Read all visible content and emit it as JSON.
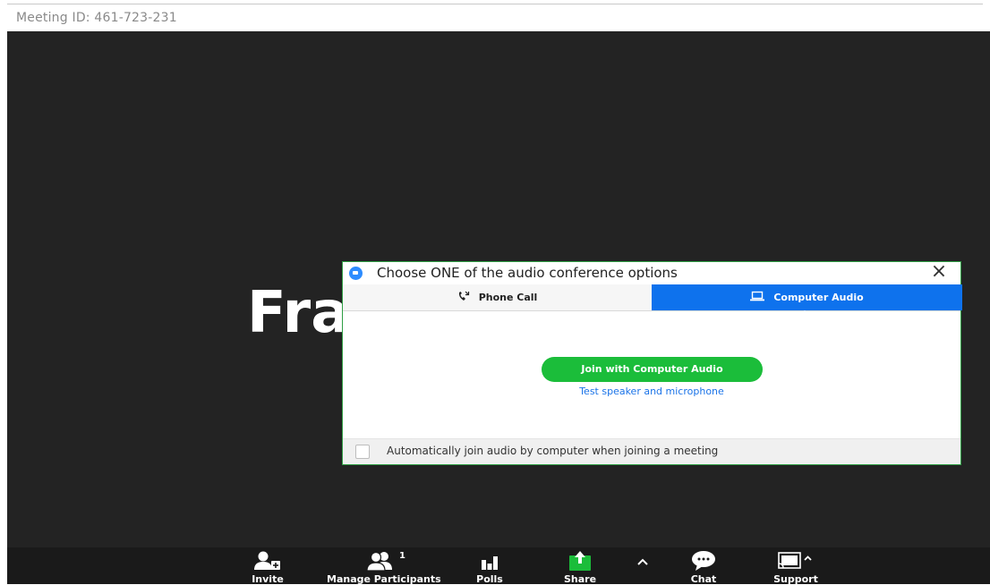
{
  "header": {
    "meeting_id": "Meeting ID: 461-723-231"
  },
  "stage": {
    "speaker_name_partial": "Fra"
  },
  "dialog": {
    "title": "Choose ONE of the audio conference options",
    "tabs": [
      {
        "label": "Phone Call",
        "icon": "phone-icon",
        "selected": false
      },
      {
        "label": "Computer Audio",
        "icon": "laptop-icon",
        "selected": true
      }
    ],
    "join_button_label": "Join with Computer Audio",
    "test_link_label": "Test speaker and microphone",
    "auto_join_label": "Automatically join audio by computer when joining a meeting",
    "auto_join_checked": false
  },
  "toolbar": {
    "items": [
      {
        "label": "Invite",
        "icon": "invite-icon"
      },
      {
        "label": "Manage Participants",
        "icon": "participants-icon",
        "badge": "1"
      },
      {
        "label": "Polls",
        "icon": "polls-icon"
      },
      {
        "label": "Share",
        "icon": "share-icon"
      },
      {
        "label": "Chat",
        "icon": "chat-icon"
      },
      {
        "label": "Support",
        "icon": "support-icon"
      }
    ]
  },
  "colors": {
    "accent_blue": "#0e72ed",
    "join_green": "#1bbd3a",
    "share_green": "#1bbd3a",
    "stage_bg": "#232323"
  }
}
